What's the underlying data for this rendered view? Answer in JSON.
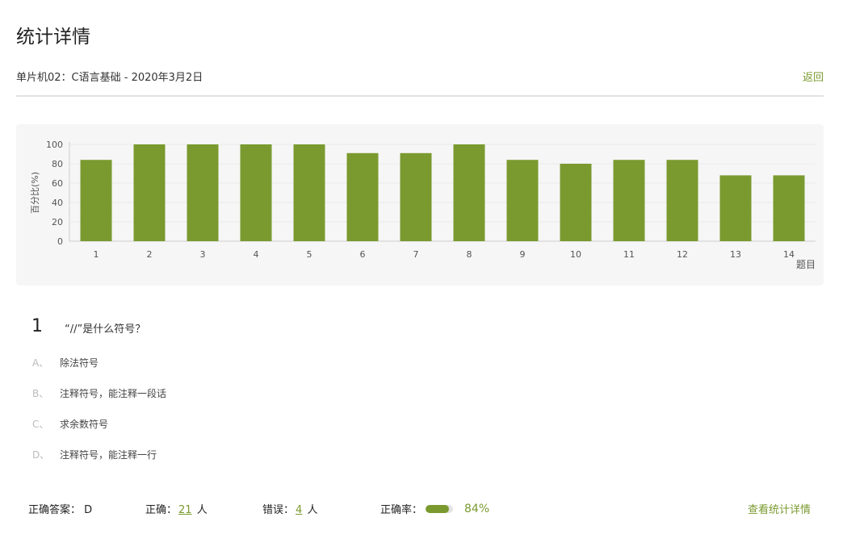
{
  "page": {
    "title": "统计详情"
  },
  "header": {
    "subtitle": "单片机02：C语言基础 - 2020年3月2日",
    "back_label": "返回"
  },
  "chart_data": {
    "type": "bar",
    "categories": [
      "1",
      "2",
      "3",
      "4",
      "5",
      "6",
      "7",
      "8",
      "9",
      "10",
      "11",
      "12",
      "13",
      "14"
    ],
    "values": [
      84,
      100,
      100,
      100,
      100,
      91,
      91,
      100,
      84,
      80,
      84,
      84,
      68,
      68
    ],
    "ylabel": "百分比(%)",
    "xlabel": "题目",
    "ylim": [
      0,
      100
    ],
    "yticks": [
      0,
      20,
      40,
      60,
      80,
      100
    ],
    "grid": true,
    "color": "#7a9a2f"
  },
  "question": {
    "number": "1",
    "text": "“//”是什么符号？",
    "options": [
      {
        "letter": "A、",
        "text": "除法符号"
      },
      {
        "letter": "B、",
        "text": "注释符号，能注释一段话"
      },
      {
        "letter": "C、",
        "text": "求余数符号"
      },
      {
        "letter": "D、",
        "text": "注释符号，能注释一行"
      }
    ]
  },
  "stats": {
    "answer_label": "正确答案：",
    "answer_value": "D",
    "correct_label": "正确：",
    "correct_count": "21",
    "correct_unit": "人",
    "wrong_label": "错误：",
    "wrong_count": "4",
    "wrong_unit": "人",
    "rate_label": "正确率：",
    "rate_value": "84%",
    "rate_fraction": 0.84,
    "detail_link": "查看统计详情"
  },
  "colors": {
    "accent": "#7a9a2f",
    "panel": "#f6f6f6"
  }
}
